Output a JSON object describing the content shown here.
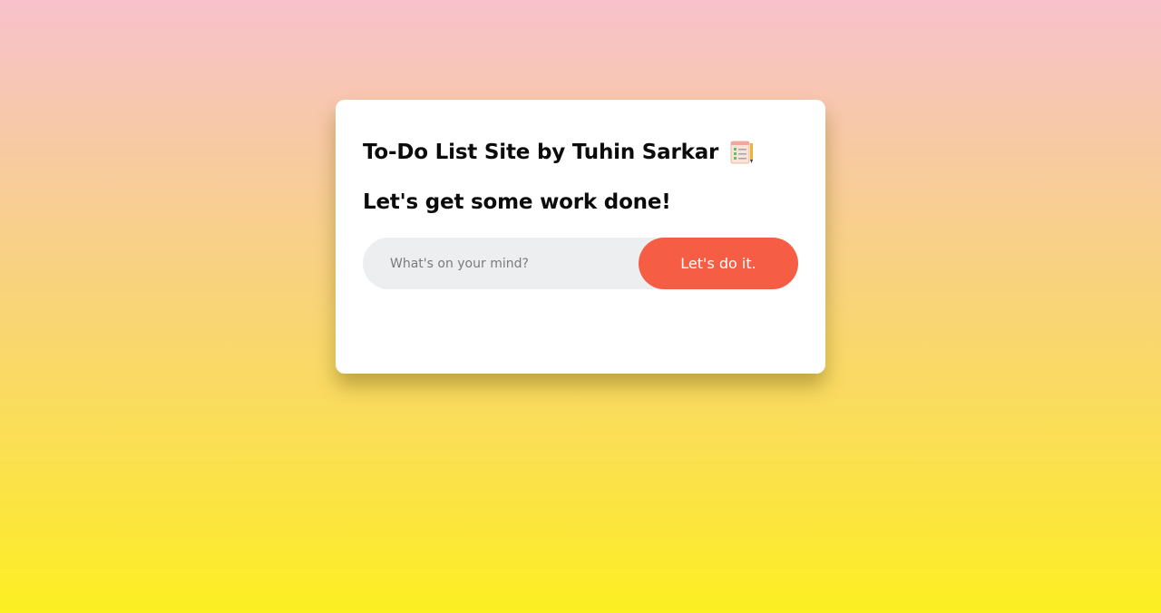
{
  "header": {
    "title": "To-Do List Site by Tuhin Sarkar",
    "title_icon": "notepad-checklist-icon",
    "subtitle": "Let's get some work done!"
  },
  "input": {
    "value": "",
    "placeholder": "What's on your mind?"
  },
  "add_button": {
    "label": "Let's do it."
  },
  "tasks": [],
  "colors": {
    "accent": "#f55d45",
    "card": "#ffffff",
    "input_bg": "#edeef0",
    "gradient_top": "#f8c1cc",
    "gradient_bottom": "#fcef22"
  }
}
